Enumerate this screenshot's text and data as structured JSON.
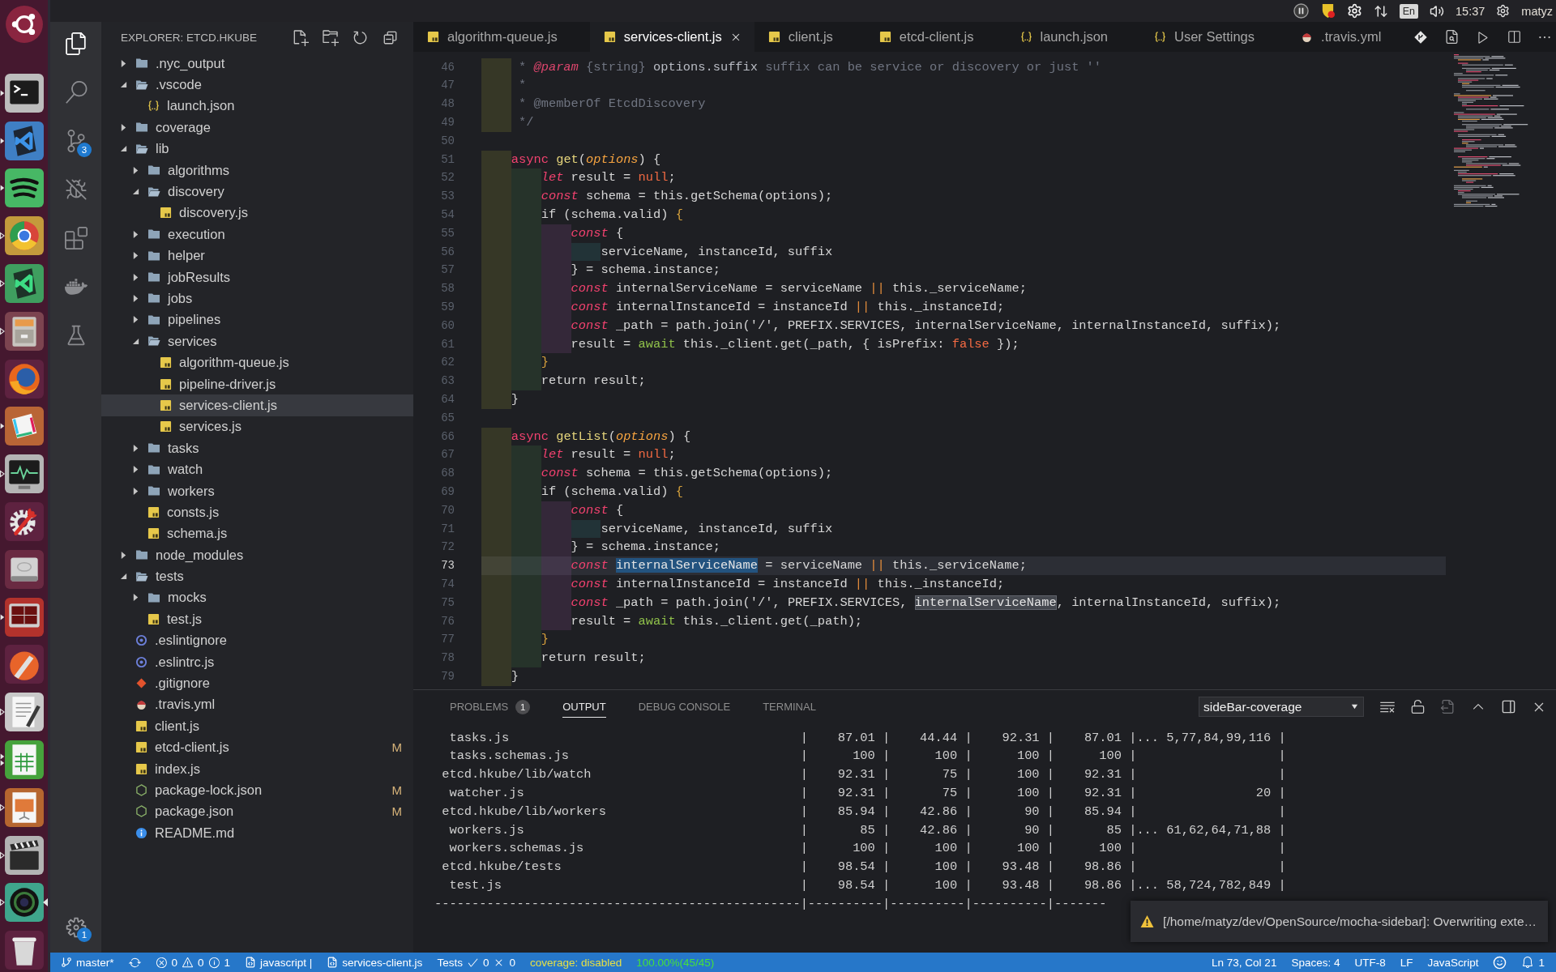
{
  "launcher": [
    {
      "kind": "dash",
      "running": false,
      "focused": false
    },
    {
      "kind": "terminal",
      "running": true,
      "hollow": false,
      "double": false,
      "focused": false
    },
    {
      "kind": "code",
      "running": true,
      "hollow": false,
      "double": false,
      "focused": false
    },
    {
      "kind": "music",
      "running": true,
      "hollow": false,
      "double": false,
      "focused": false
    },
    {
      "kind": "browser",
      "running": true,
      "hollow": true,
      "double": false,
      "focused": false
    },
    {
      "kind": "sheetx",
      "running": true,
      "hollow": true,
      "double": false,
      "focused": false
    },
    {
      "kind": "files",
      "running": true,
      "hollow": true,
      "double": false,
      "focused": false
    },
    {
      "kind": "firefox",
      "running": false,
      "focused": false
    },
    {
      "kind": "chat",
      "running": true,
      "hollow": false,
      "double": false,
      "focused": false
    },
    {
      "kind": "monitor",
      "running": true,
      "hollow": true,
      "double": false,
      "focused": false
    },
    {
      "kind": "tools",
      "running": false,
      "focused": false
    },
    {
      "kind": "disk",
      "running": false,
      "focused": false
    },
    {
      "kind": "screen",
      "running": true,
      "hollow": false,
      "double": false,
      "focused": false
    },
    {
      "kind": "pen",
      "running": false,
      "focused": false
    },
    {
      "kind": "notepad",
      "running": true,
      "hollow": true,
      "double": false,
      "focused": false
    },
    {
      "kind": "calc",
      "running": true,
      "hollow": false,
      "double": true,
      "focused": false
    },
    {
      "kind": "slides",
      "running": true,
      "hollow": true,
      "double": false,
      "focused": false
    },
    {
      "kind": "video",
      "running": true,
      "hollow": true,
      "double": false,
      "focused": false
    },
    {
      "kind": "globe",
      "running": true,
      "hollow": true,
      "double": false,
      "focused": true
    },
    {
      "kind": "trash",
      "running": false,
      "focused": false
    }
  ],
  "top_panel": {
    "keyboard": "En",
    "clock": "15:37",
    "user": "matyz"
  },
  "activity_bar": {
    "items": [
      {
        "kind": "files",
        "selected": true
      },
      {
        "kind": "search",
        "selected": false
      },
      {
        "kind": "scm",
        "selected": false,
        "badge": "3"
      },
      {
        "kind": "debug",
        "selected": false
      },
      {
        "kind": "extensions",
        "selected": false
      },
      {
        "kind": "docker",
        "selected": false
      },
      {
        "kind": "testing",
        "selected": false
      }
    ],
    "manage": {
      "badge": "1"
    }
  },
  "sidebar": {
    "title": "EXPLORER: ETCD.HKUBE",
    "tree": [
      {
        "label": ".nyc_output",
        "kind": "folder",
        "expanded": false,
        "selected": false
      },
      {
        "label": ".vscode",
        "kind": "folder",
        "expanded": true,
        "selected": false,
        "children": [
          {
            "label": "launch.json",
            "kind": "json",
            "selected": false
          }
        ]
      },
      {
        "label": "coverage",
        "kind": "folder",
        "expanded": false,
        "selected": false
      },
      {
        "label": "lib",
        "kind": "folder",
        "expanded": true,
        "selected": false,
        "children": [
          {
            "label": "algorithms",
            "kind": "folder",
            "expanded": false,
            "selected": false
          },
          {
            "label": "discovery",
            "kind": "folder",
            "expanded": true,
            "selected": false,
            "children": [
              {
                "label": "discovery.js",
                "kind": "js",
                "selected": false
              }
            ]
          },
          {
            "label": "execution",
            "kind": "folder",
            "expanded": false,
            "selected": false
          },
          {
            "label": "helper",
            "kind": "folder",
            "expanded": false,
            "selected": false
          },
          {
            "label": "jobResults",
            "kind": "folder",
            "expanded": false,
            "selected": false
          },
          {
            "label": "jobs",
            "kind": "folder",
            "expanded": false,
            "selected": false
          },
          {
            "label": "pipelines",
            "kind": "folder",
            "expanded": false,
            "selected": false
          },
          {
            "label": "services",
            "kind": "folder",
            "expanded": true,
            "selected": false,
            "children": [
              {
                "label": "algorithm-queue.js",
                "kind": "js",
                "selected": false
              },
              {
                "label": "pipeline-driver.js",
                "kind": "js",
                "selected": false
              },
              {
                "label": "services-client.js",
                "kind": "js",
                "selected": true
              },
              {
                "label": "services.js",
                "kind": "js",
                "selected": false
              }
            ]
          },
          {
            "label": "tasks",
            "kind": "folder",
            "expanded": false,
            "selected": false
          },
          {
            "label": "watch",
            "kind": "folder",
            "expanded": false,
            "selected": false
          },
          {
            "label": "workers",
            "kind": "folder",
            "expanded": false,
            "selected": false
          },
          {
            "label": "consts.js",
            "kind": "js",
            "selected": false
          },
          {
            "label": "schema.js",
            "kind": "js",
            "selected": false
          }
        ]
      },
      {
        "label": "node_modules",
        "kind": "folder",
        "expanded": false,
        "selected": false
      },
      {
        "label": "tests",
        "kind": "folder",
        "expanded": true,
        "selected": false,
        "children": [
          {
            "label": "mocks",
            "kind": "folder",
            "expanded": false,
            "selected": false
          },
          {
            "label": "test.js",
            "kind": "js",
            "selected": false
          }
        ]
      },
      {
        "label": ".eslintignore",
        "kind": "eslint",
        "selected": false
      },
      {
        "label": ".eslintrc.js",
        "kind": "eslint",
        "selected": false
      },
      {
        "label": ".gitignore",
        "kind": "git",
        "selected": false
      },
      {
        "label": ".travis.yml",
        "kind": "travis",
        "selected": false
      },
      {
        "label": "client.js",
        "kind": "js",
        "selected": false
      },
      {
        "label": "etcd-client.js",
        "kind": "js",
        "selected": false,
        "status": "M"
      },
      {
        "label": "index.js",
        "kind": "js",
        "selected": false
      },
      {
        "label": "package-lock.json",
        "kind": "npm",
        "selected": false,
        "status": "M"
      },
      {
        "label": "package.json",
        "kind": "npm",
        "selected": false,
        "status": "M"
      },
      {
        "label": "README.md",
        "kind": "info",
        "selected": false
      }
    ]
  },
  "tabs": [
    {
      "label": "algorithm-queue.js",
      "kind": "js",
      "selected": false
    },
    {
      "label": "services-client.js",
      "kind": "js",
      "selected": true
    },
    {
      "label": "client.js",
      "kind": "js",
      "selected": false
    },
    {
      "label": "etcd-client.js",
      "kind": "js",
      "selected": false
    },
    {
      "label": "launch.json",
      "kind": "json",
      "selected": false
    },
    {
      "label": "User Settings",
      "kind": "json",
      "selected": false
    },
    {
      "label": ".travis.yml",
      "kind": "travis",
      "selected": false
    }
  ],
  "editor": {
    "lines": [
      {
        "number": "46",
        "current": false,
        "tokens": [
          {
            "kind": "comment",
            "text": "     * "
          },
          {
            "kind": "doctag",
            "text": "@param"
          },
          {
            "kind": "comment",
            "text": " {string} "
          },
          {
            "kind": "docname",
            "text": "options.suffix"
          },
          {
            "kind": "comment",
            "text": " suffix can be service or discovery or just ''"
          }
        ]
      },
      {
        "number": "47",
        "current": false,
        "tokens": [
          {
            "kind": "comment",
            "text": "     *"
          }
        ]
      },
      {
        "number": "48",
        "current": false,
        "tokens": [
          {
            "kind": "comment",
            "text": "     * @memberOf EtcdDiscovery"
          }
        ]
      },
      {
        "number": "49",
        "current": false,
        "tokens": [
          {
            "kind": "comment",
            "text": "     */"
          }
        ]
      },
      {
        "number": "50",
        "current": false
      },
      {
        "number": "51",
        "current": false,
        "tokens": [
          {
            "kind": "keyword",
            "text": "    async "
          },
          {
            "kind": "function",
            "text": "get"
          },
          {
            "kind": "plain",
            "text": "("
          },
          {
            "kind": "param",
            "text": "options"
          },
          {
            "kind": "plain",
            "text": ") {"
          }
        ]
      },
      {
        "number": "52",
        "current": false,
        "tokens": [
          {
            "kind": "storage",
            "text": "        let"
          },
          {
            "kind": "plain",
            "text": " result = "
          },
          {
            "kind": "constant",
            "text": "null"
          },
          {
            "kind": "plain",
            "text": ";"
          }
        ]
      },
      {
        "number": "53",
        "current": false,
        "tokens": [
          {
            "kind": "storage",
            "text": "        const"
          },
          {
            "kind": "plain",
            "text": " schema = this.getSchema(options);"
          }
        ]
      },
      {
        "number": "54",
        "current": false,
        "tokens": [
          {
            "kind": "plain",
            "text": "        if (schema.valid) "
          },
          {
            "kind": "bracket",
            "text": "{"
          }
        ]
      },
      {
        "number": "55",
        "current": false,
        "tokens": [
          {
            "kind": "storage",
            "text": "            const"
          },
          {
            "kind": "plain",
            "text": " {"
          }
        ]
      },
      {
        "number": "56",
        "current": false,
        "tokens": [
          {
            "kind": "plain",
            "text": "                serviceName, instanceId, suffix"
          }
        ]
      },
      {
        "number": "57",
        "current": false,
        "tokens": [
          {
            "kind": "plain",
            "text": "            } = schema.instance;"
          }
        ]
      },
      {
        "number": "58",
        "current": false,
        "tokens": [
          {
            "kind": "storage",
            "text": "            const"
          },
          {
            "kind": "plain",
            "text": " internalServiceName = serviceName "
          },
          {
            "kind": "operator",
            "text": "||"
          },
          {
            "kind": "plain",
            "text": " this._serviceName;"
          }
        ]
      },
      {
        "number": "59",
        "current": false,
        "tokens": [
          {
            "kind": "storage",
            "text": "            const"
          },
          {
            "kind": "plain",
            "text": " internalInstanceId = instanceId "
          },
          {
            "kind": "operator",
            "text": "||"
          },
          {
            "kind": "plain",
            "text": " this._instanceId;"
          }
        ]
      },
      {
        "number": "60",
        "current": false,
        "tokens": [
          {
            "kind": "storage",
            "text": "            const"
          },
          {
            "kind": "plain",
            "text": " _path = path.join('/', PREFIX.SERVICES, internalServiceName, internalInstanceId, suffix);"
          }
        ]
      },
      {
        "number": "61",
        "current": false,
        "tokens": [
          {
            "kind": "plain",
            "text": "            result = "
          },
          {
            "kind": "await",
            "text": "await"
          },
          {
            "kind": "plain",
            "text": " this._client.get(_path, { isPrefix: "
          },
          {
            "kind": "constant",
            "text": "false"
          },
          {
            "kind": "plain",
            "text": " });"
          }
        ]
      },
      {
        "number": "62",
        "current": false,
        "tokens": [
          {
            "kind": "bracket",
            "text": "        }"
          }
        ]
      },
      {
        "number": "63",
        "current": false,
        "tokens": [
          {
            "kind": "plain",
            "text": "        return result;"
          }
        ]
      },
      {
        "number": "64",
        "current": false,
        "tokens": [
          {
            "kind": "plain",
            "text": "    }"
          }
        ]
      },
      {
        "number": "65",
        "current": false
      },
      {
        "number": "66",
        "current": false,
        "tokens": [
          {
            "kind": "keyword",
            "text": "    async "
          },
          {
            "kind": "function",
            "text": "getList"
          },
          {
            "kind": "plain",
            "text": "("
          },
          {
            "kind": "param",
            "text": "options"
          },
          {
            "kind": "plain",
            "text": ") {"
          }
        ]
      },
      {
        "number": "67",
        "current": false,
        "tokens": [
          {
            "kind": "storage",
            "text": "        let"
          },
          {
            "kind": "plain",
            "text": " result = "
          },
          {
            "kind": "constant",
            "text": "null"
          },
          {
            "kind": "plain",
            "text": ";"
          }
        ]
      },
      {
        "number": "68",
        "current": false,
        "tokens": [
          {
            "kind": "storage",
            "text": "        const"
          },
          {
            "kind": "plain",
            "text": " schema = this.getSchema(options);"
          }
        ]
      },
      {
        "number": "69",
        "current": false,
        "tokens": [
          {
            "kind": "plain",
            "text": "        if (schema.valid) "
          },
          {
            "kind": "bracket",
            "text": "{"
          }
        ]
      },
      {
        "number": "70",
        "current": false,
        "tokens": [
          {
            "kind": "storage",
            "text": "            const"
          },
          {
            "kind": "plain",
            "text": " {"
          }
        ]
      },
      {
        "number": "71",
        "current": false,
        "tokens": [
          {
            "kind": "plain",
            "text": "                serviceName, instanceId, suffix"
          }
        ]
      },
      {
        "number": "72",
        "current": false,
        "tokens": [
          {
            "kind": "plain",
            "text": "            } = schema.instance;"
          }
        ]
      },
      {
        "number": "73",
        "current": true,
        "tokens": [
          {
            "kind": "storage",
            "text": "            const "
          },
          {
            "kind": "selected",
            "text": "internalServiceName"
          },
          {
            "kind": "plain",
            "text": " = serviceName "
          },
          {
            "kind": "operator",
            "text": "||"
          },
          {
            "kind": "plain",
            "text": " this._serviceName;"
          }
        ]
      },
      {
        "number": "74",
        "current": false,
        "tokens": [
          {
            "kind": "storage",
            "text": "            const"
          },
          {
            "kind": "plain",
            "text": " internalInstanceId = instanceId "
          },
          {
            "kind": "operator",
            "text": "||"
          },
          {
            "kind": "plain",
            "text": " this._instanceId;"
          }
        ]
      },
      {
        "number": "75",
        "current": false,
        "tokens": [
          {
            "kind": "storage",
            "text": "            const"
          },
          {
            "kind": "plain",
            "text": " _path = path.join('/', PREFIX.SERVICES, "
          },
          {
            "kind": "occurrence",
            "text": "internalServiceName"
          },
          {
            "kind": "plain",
            "text": ", internalInstanceId, suffix);"
          }
        ]
      },
      {
        "number": "76",
        "current": false,
        "tokens": [
          {
            "kind": "plain",
            "text": "            result = "
          },
          {
            "kind": "await",
            "text": "await"
          },
          {
            "kind": "plain",
            "text": " this._client.get(_path);"
          }
        ]
      },
      {
        "number": "77",
        "current": false,
        "tokens": [
          {
            "kind": "bracket",
            "text": "        }"
          }
        ]
      },
      {
        "number": "78",
        "current": false,
        "tokens": [
          {
            "kind": "plain",
            "text": "        return result;"
          }
        ]
      },
      {
        "number": "79",
        "current": false,
        "tokens": [
          {
            "kind": "plain",
            "text": "    }"
          }
        ]
      }
    ]
  },
  "panel": {
    "tabs": [
      {
        "label": "PROBLEMS",
        "badge": "1",
        "selected": false
      },
      {
        "label": "OUTPUT",
        "selected": true
      },
      {
        "label": "DEBUG CONSOLE",
        "selected": false
      },
      {
        "label": "TERMINAL",
        "selected": false
      }
    ],
    "dropdown": "sideBar-coverage",
    "output": [
      "  tasks.js                                       |    87.01 |    44.44 |    92.31 |    87.01 |... 5,77,84,99,116 |",
      "  tasks.schemas.js                               |      100 |      100 |      100 |      100 |                   |",
      " etcd.hkube/lib/watch                            |    92.31 |       75 |      100 |    92.31 |                   |",
      "  watcher.js                                     |    92.31 |       75 |      100 |    92.31 |                20 |",
      " etcd.hkube/lib/workers                          |    85.94 |    42.86 |       90 |    85.94 |                   |",
      "  workers.js                                     |       85 |    42.86 |       90 |       85 |... 61,62,64,71,88 |",
      "  workers.schemas.js                             |      100 |      100 |      100 |      100 |                   |",
      " etcd.hkube/tests                                |    98.54 |      100 |    93.48 |    98.86 |                   |",
      "  test.js                                        |    98.54 |      100 |    93.48 |    98.86 |... 58,724,782,849 |",
      "-------------------------------------------------|----------|----------|----------|-------"
    ]
  },
  "notification": {
    "text": "[/home/matyz/dev/OpenSource/mocha-sidebar]: Overwriting exte…"
  },
  "status_bar": {
    "left": [
      {
        "kind": "branch",
        "text": "master*"
      },
      {
        "kind": "sync"
      },
      {
        "kind": "problems",
        "errors": "0",
        "warnings": "0",
        "infos": "1"
      },
      {
        "kind": "language",
        "text": "javascript |"
      },
      {
        "kind": "file",
        "text": "services-client.js"
      },
      {
        "kind": "tests",
        "text": "Tests",
        "passed": "0",
        "failed": "0"
      },
      {
        "kind": "coverage",
        "text": "coverage: disabled",
        "color": "#e6e045"
      },
      {
        "kind": "percent",
        "text": "100.00%(45/45)",
        "color": "#45e03c"
      }
    ],
    "right": [
      {
        "kind": "position",
        "text": "Ln 73, Col 21"
      },
      {
        "kind": "indent",
        "text": "Spaces: 4"
      },
      {
        "kind": "encoding",
        "text": "UTF-8"
      },
      {
        "kind": "eol",
        "text": "LF"
      },
      {
        "kind": "mode",
        "text": "JavaScript"
      },
      {
        "kind": "feedback"
      },
      {
        "kind": "bell",
        "text": "1"
      }
    ]
  }
}
